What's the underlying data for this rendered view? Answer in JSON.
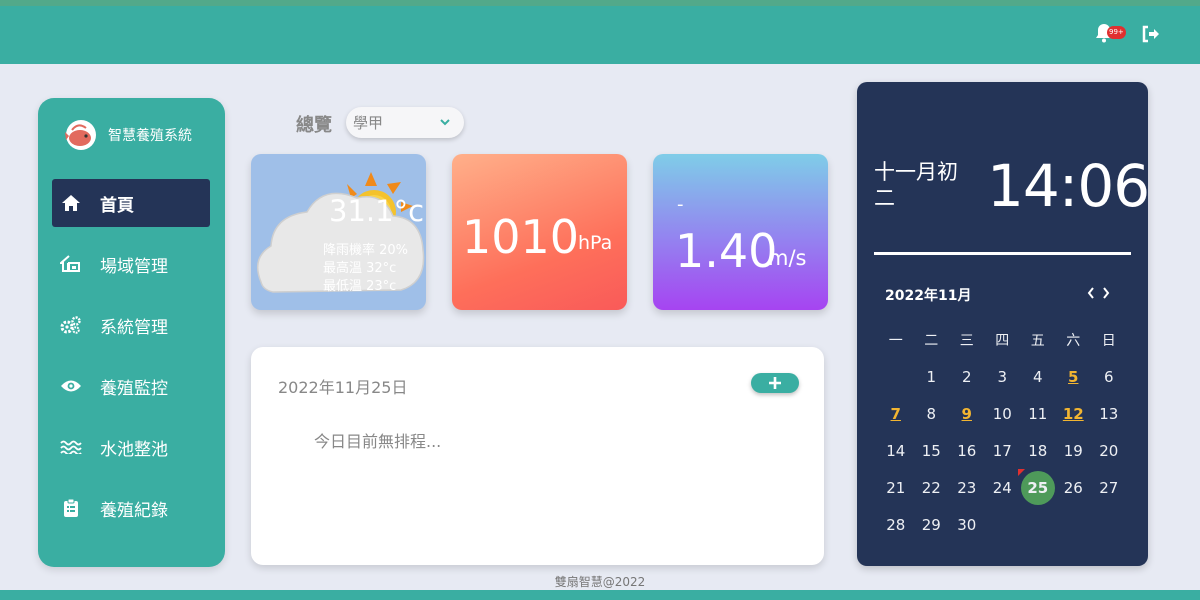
{
  "header": {
    "notifications_badge": "99+",
    "bell_icon": "bell-icon",
    "logout_icon": "logout-icon"
  },
  "sidebar": {
    "brand_name": "智慧養殖系統",
    "brand_logo": "fish-logo",
    "items": [
      {
        "label": "首頁",
        "icon": "home-icon",
        "active": true
      },
      {
        "label": "場域管理",
        "icon": "house-icon",
        "active": false
      },
      {
        "label": "系統管理",
        "icon": "gears-icon",
        "active": false
      },
      {
        "label": "養殖監控",
        "icon": "eye-icon",
        "active": false
      },
      {
        "label": "水池整池",
        "icon": "water-icon",
        "active": false
      },
      {
        "label": "養殖紀錄",
        "icon": "clipboard-icon",
        "active": false
      }
    ]
  },
  "overview": {
    "title": "總覽",
    "selected_site": "學甲"
  },
  "weather": {
    "temperature": "31.1°c",
    "rain_chance": "降雨機率 20%",
    "high_temp": "最高溫 32°c",
    "low_temp": "最低溫 23°c",
    "icon": "partly-cloudy-icon"
  },
  "pressure": {
    "value": "1010",
    "unit": "hPa"
  },
  "wind": {
    "direction": "-",
    "value": "1.40",
    "unit": "m/s"
  },
  "schedule": {
    "date": "2022年11月25日",
    "empty_text": "今日目前無排程...",
    "add_icon": "plus-icon"
  },
  "clock": {
    "lunar_date": "十一月初二",
    "time": "14:06"
  },
  "calendar": {
    "month_label": "2022年11月",
    "weekdays": [
      "一",
      "二",
      "三",
      "四",
      "五",
      "六",
      "日"
    ],
    "weeks": [
      [
        "",
        "1",
        "2",
        "3",
        "4",
        "5",
        "6"
      ],
      [
        "7",
        "8",
        "9",
        "10",
        "11",
        "12",
        "13"
      ],
      [
        "14",
        "15",
        "16",
        "17",
        "18",
        "19",
        "20"
      ],
      [
        "21",
        "22",
        "23",
        "24",
        "25",
        "26",
        "27"
      ],
      [
        "28",
        "29",
        "30",
        "",
        "",
        "",
        ""
      ]
    ],
    "highlighted_days": [
      "5",
      "7",
      "9",
      "12"
    ],
    "today": "25",
    "flagged_day": "25",
    "highlight_color": "#f2b531",
    "today_color": "#4e9a5a"
  },
  "footer": {
    "text": "雙扇智慧@2022"
  },
  "colors": {
    "primary": "#3aaea2",
    "panel": "#243457",
    "background": "#e7eaf3"
  }
}
